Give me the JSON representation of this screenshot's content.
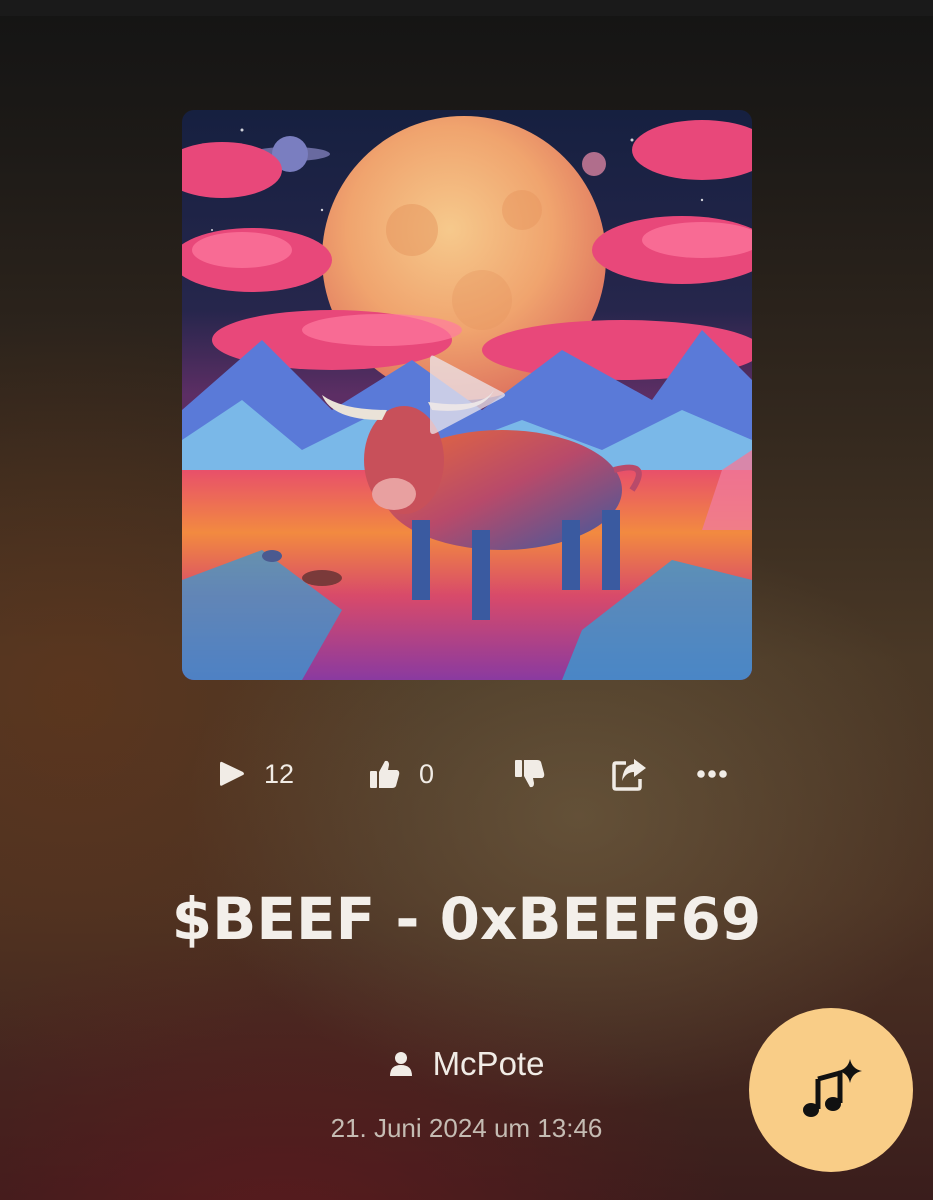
{
  "track": {
    "title": "$BEEF - 0xBEEF69",
    "author": "McPote",
    "date": "21. Juni 2024 um 13:46",
    "cover_icon": "cover-art",
    "play_overlay_icon": "play-icon"
  },
  "stats": {
    "plays": "12",
    "likes": "0",
    "play_icon": "play-icon",
    "like_icon": "thumbs-up-icon",
    "dislike_icon": "thumbs-down-icon",
    "share_icon": "share-icon",
    "more_icon": "more-icon"
  },
  "fab": {
    "icon": "music-sparkle-icon"
  },
  "colors": {
    "fab": "#f9cd87",
    "text": "#f1ece6",
    "date": "#c5bcb3"
  }
}
